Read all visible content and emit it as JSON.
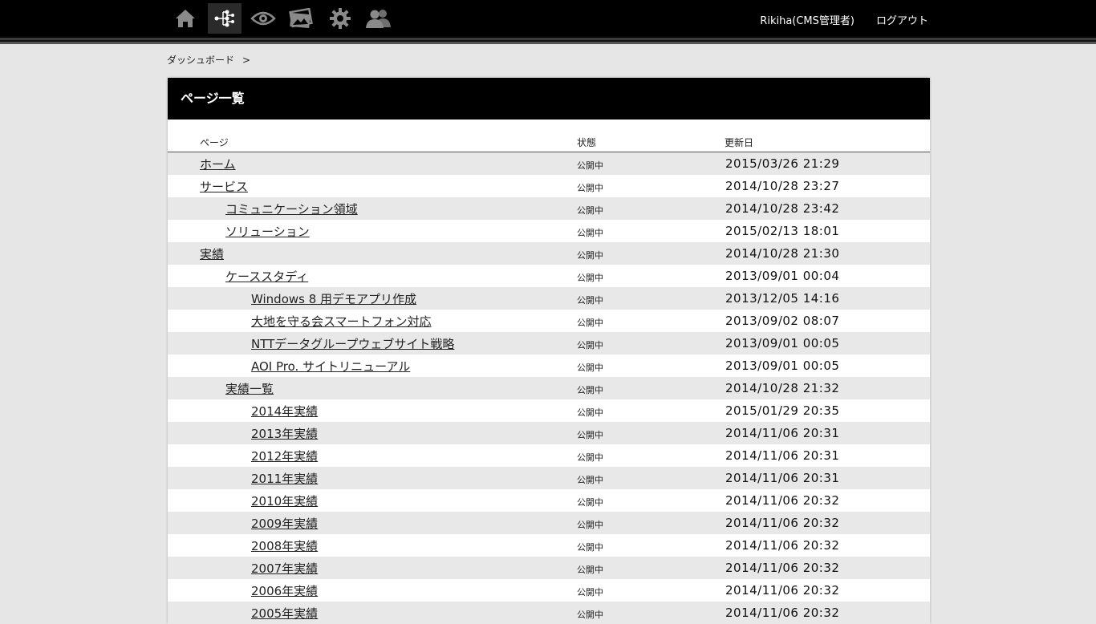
{
  "nav": {
    "icons": [
      {
        "name": "home-icon"
      },
      {
        "name": "sitemap-icon"
      },
      {
        "name": "eye-icon"
      },
      {
        "name": "images-icon"
      },
      {
        "name": "gear-icon"
      },
      {
        "name": "users-icon"
      }
    ],
    "user_label": "Rikiha(CMS管理者)",
    "logout_label": "ログアウト"
  },
  "breadcrumb": {
    "root": "ダッシュボード",
    "separator": ">"
  },
  "panel": {
    "title": "ページ一覧",
    "columns": {
      "page": "ページ",
      "status": "状態",
      "updated": "更新日"
    },
    "rows": [
      {
        "title": "ホーム",
        "level": 0,
        "status": "公開中",
        "updated": "2015/03/26 21:29"
      },
      {
        "title": "サービス",
        "level": 0,
        "status": "公開中",
        "updated": "2014/10/28 23:27"
      },
      {
        "title": "コミュニケーション領域",
        "level": 1,
        "status": "公開中",
        "updated": "2014/10/28 23:42"
      },
      {
        "title": "ソリューション",
        "level": 1,
        "status": "公開中",
        "updated": "2015/02/13 18:01"
      },
      {
        "title": "実績",
        "level": 0,
        "status": "公開中",
        "updated": "2014/10/28 21:30"
      },
      {
        "title": "ケーススタディ",
        "level": 1,
        "status": "公開中",
        "updated": "2013/09/01 00:04"
      },
      {
        "title": "Windows 8 用デモアプリ作成",
        "level": 2,
        "status": "公開中",
        "updated": "2013/12/05 14:16"
      },
      {
        "title": "大地を守る会スマートフォン対応",
        "level": 2,
        "status": "公開中",
        "updated": "2013/09/02 08:07"
      },
      {
        "title": "NTTデータグループウェブサイト戦略",
        "level": 2,
        "status": "公開中",
        "updated": "2013/09/01 00:05"
      },
      {
        "title": "AOI Pro. サイトリニューアル",
        "level": 2,
        "status": "公開中",
        "updated": "2013/09/01 00:05"
      },
      {
        "title": "実績一覧",
        "level": 1,
        "status": "公開中",
        "updated": "2014/10/28 21:32"
      },
      {
        "title": "2014年実績",
        "level": 2,
        "status": "公開中",
        "updated": "2015/01/29 20:35"
      },
      {
        "title": "2013年実績",
        "level": 2,
        "status": "公開中",
        "updated": "2014/11/06 20:31"
      },
      {
        "title": "2012年実績",
        "level": 2,
        "status": "公開中",
        "updated": "2014/11/06 20:31"
      },
      {
        "title": "2011年実績",
        "level": 2,
        "status": "公開中",
        "updated": "2014/11/06 20:31"
      },
      {
        "title": "2010年実績",
        "level": 2,
        "status": "公開中",
        "updated": "2014/11/06 20:32"
      },
      {
        "title": "2009年実績",
        "level": 2,
        "status": "公開中",
        "updated": "2014/11/06 20:32"
      },
      {
        "title": "2008年実績",
        "level": 2,
        "status": "公開中",
        "updated": "2014/11/06 20:32"
      },
      {
        "title": "2007年実績",
        "level": 2,
        "status": "公開中",
        "updated": "2014/11/06 20:32"
      },
      {
        "title": "2006年実績",
        "level": 2,
        "status": "公開中",
        "updated": "2014/11/06 20:32"
      },
      {
        "title": "2005年実績",
        "level": 2,
        "status": "公開中",
        "updated": "2014/11/06 20:32"
      }
    ]
  }
}
